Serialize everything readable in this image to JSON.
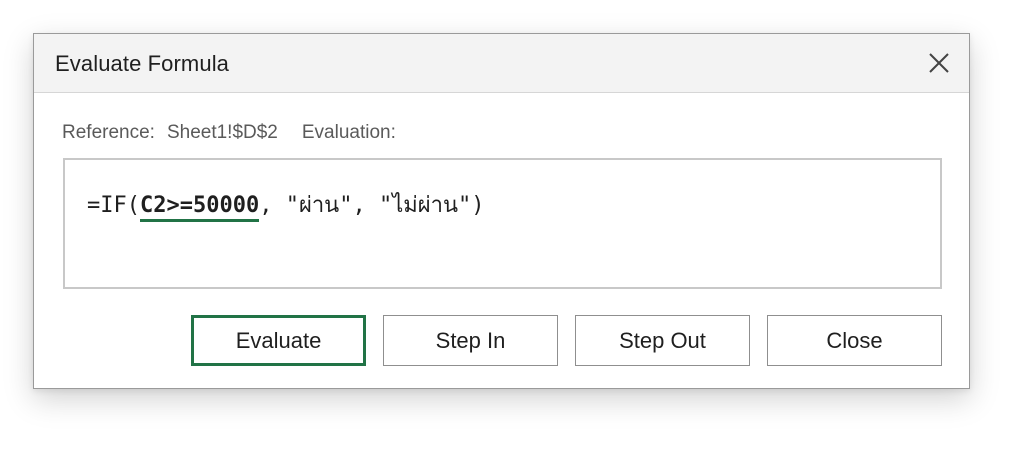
{
  "dialog": {
    "title": "Evaluate Formula",
    "close_icon": "close-icon"
  },
  "reference": {
    "label": "Reference:",
    "value": "Sheet1!$D$2",
    "evaluation_label": "Evaluation:"
  },
  "formula": {
    "prefix": "=IF(",
    "highlighted": "C2>=50000",
    "suffix": ", \"ผ่าน\", \"ไม่ผ่าน\")"
  },
  "buttons": {
    "evaluate": "Evaluate",
    "step_in": "Step In",
    "step_out": "Step Out",
    "close": "Close"
  },
  "colors": {
    "accent": "#217346",
    "titlebar_bg": "#f3f3f3",
    "border": "#c8c8c8"
  }
}
